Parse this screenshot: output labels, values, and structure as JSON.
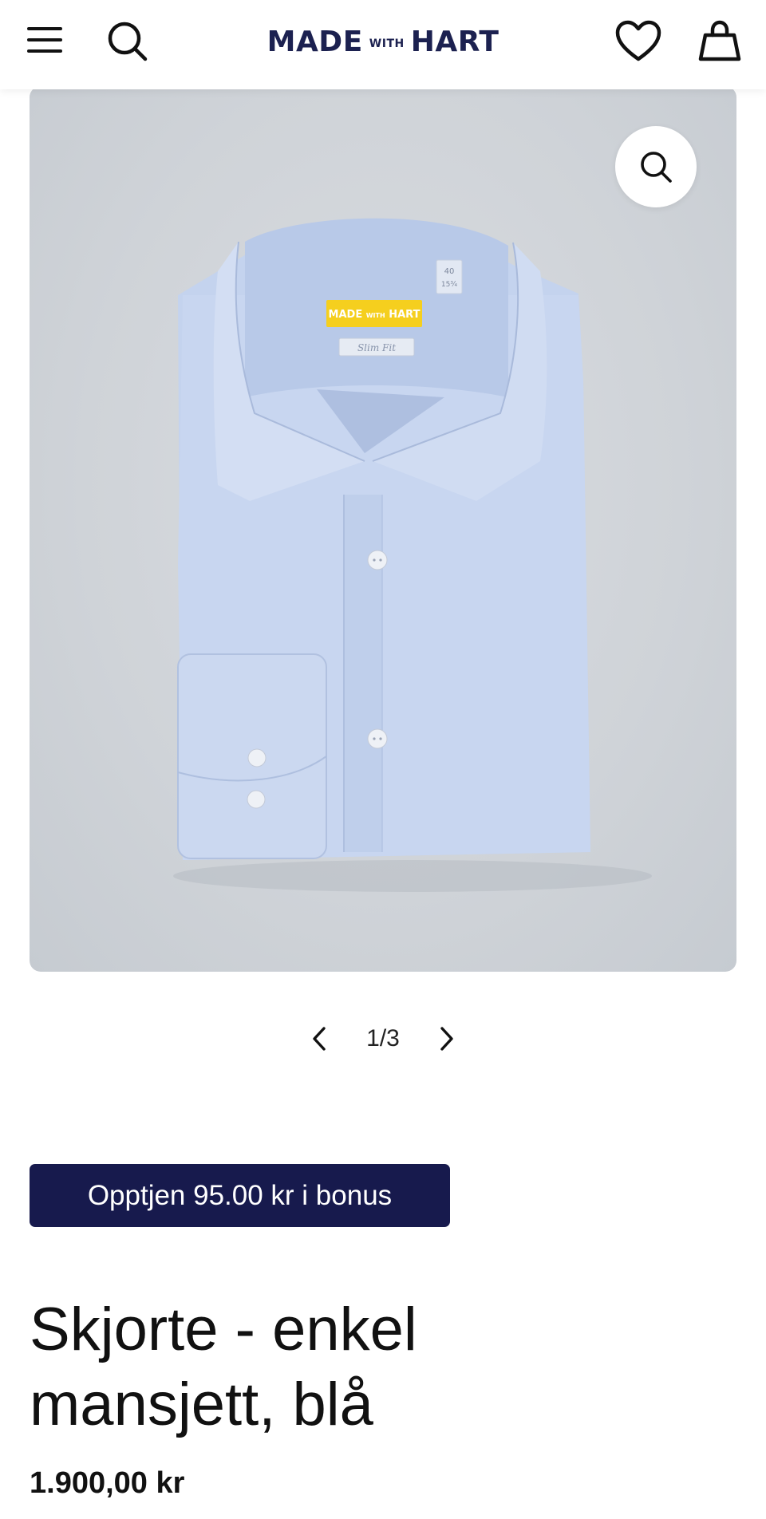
{
  "header": {
    "logo": {
      "part1": "MADE",
      "part2": "WITH",
      "part3": "HART",
      "color": "#1c2150"
    },
    "icons": [
      "menu-icon",
      "search-icon",
      "heart-icon",
      "bag-icon"
    ]
  },
  "gallery": {
    "shirt_label": {
      "part1": "MADE",
      "part2": "WITH",
      "part3": "HART"
    },
    "fit_label": "Slim Fit",
    "size_tag": [
      "40",
      "15¾"
    ],
    "zoom_icon": "search-icon",
    "pager": {
      "text": "1/3",
      "prev_icon": "chevron-left-icon",
      "next_icon": "chevron-right-icon"
    }
  },
  "product": {
    "bonus": "Opptjen 95.00 kr i bonus",
    "title_line1": "Skjorte - enkel",
    "title_line2": "mansjett, blå",
    "price": "1.900,00 kr"
  },
  "colors": {
    "brand": "#1c2150",
    "bonus_bg": "#171a4d",
    "shirt_label": "#f5cf1e"
  }
}
